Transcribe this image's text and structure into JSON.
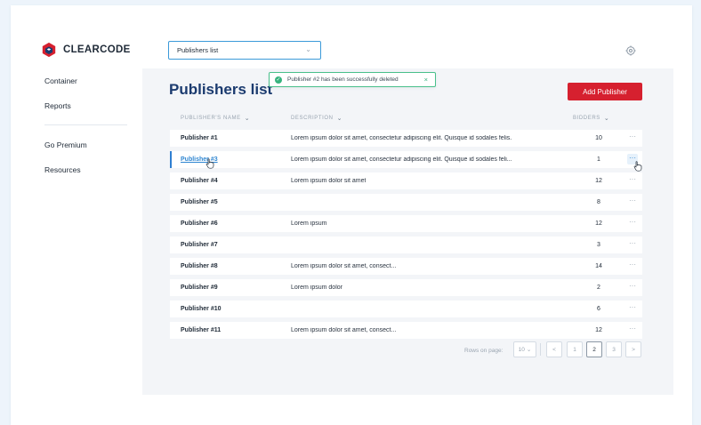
{
  "brand": {
    "name": "CLEARCODE",
    "logo_colors": [
      "#d6202f",
      "#1b3b6f"
    ]
  },
  "view_select": {
    "value": "Publishers list"
  },
  "sidebar": {
    "items": [
      {
        "label": "Container"
      },
      {
        "label": "Reports"
      },
      {
        "label": "Go Premium"
      },
      {
        "label": "Resources"
      }
    ]
  },
  "page": {
    "title": "Publishers list",
    "add_label": "Add Publisher"
  },
  "toast": {
    "message": "Publisher #2 has been successfully deleted",
    "close": "×",
    "check": "✓"
  },
  "table": {
    "headers": {
      "name": "PUBLISHER'S NAME",
      "description": "DESCRIPTION",
      "bidders": "BIDDERS",
      "sort_chevron": "⌄"
    },
    "rows": [
      {
        "name": "Publisher #1",
        "description": "Lorem ipsum dolor sit amet, consectetur adipiscing elit. Quisque id sodales felis.",
        "bidders": "10",
        "menu": "···"
      },
      {
        "name": "Publisher #3",
        "description": "Lorem ipsum dolor sit amet, consectetur adipiscing elit. Quisque id sodales feli...",
        "bidders": "1",
        "menu": "···"
      },
      {
        "name": "Publisher #4",
        "description": "Lorem ipsum dolor sit amet",
        "bidders": "12",
        "menu": "···"
      },
      {
        "name": "Publisher #5",
        "description": "",
        "bidders": "8",
        "menu": "···"
      },
      {
        "name": "Publisher #6",
        "description": "Lorem ipsum",
        "bidders": "12",
        "menu": "···"
      },
      {
        "name": "Publisher #7",
        "description": "",
        "bidders": "3",
        "menu": "···"
      },
      {
        "name": "Publisher #8",
        "description": "Lorem ipsum dolor sit amet, consect...",
        "bidders": "14",
        "menu": "···"
      },
      {
        "name": "Publisher #9",
        "description": "Lorem ipsum dolor",
        "bidders": "2",
        "menu": "···"
      },
      {
        "name": "Publisher #10",
        "description": "",
        "bidders": "6",
        "menu": "···"
      },
      {
        "name": "Publisher #11",
        "description": "Lorem ipsum dolor sit amet, consect...",
        "bidders": "12",
        "menu": "···"
      }
    ]
  },
  "pagination": {
    "rows_label": "Rows on page:",
    "rows_value": "10",
    "prev": "<",
    "pages": [
      "1",
      "2",
      "3"
    ],
    "current_page": "2",
    "next": ">"
  },
  "colors": {
    "accent": "#d6202f",
    "title": "#1b3b6f",
    "link": "#2f86d1",
    "success": "#36b37e"
  },
  "icons": {
    "settings": "gear-icon",
    "chevron": "chevron-down-icon",
    "cursor": "hand-cursor-icon"
  }
}
